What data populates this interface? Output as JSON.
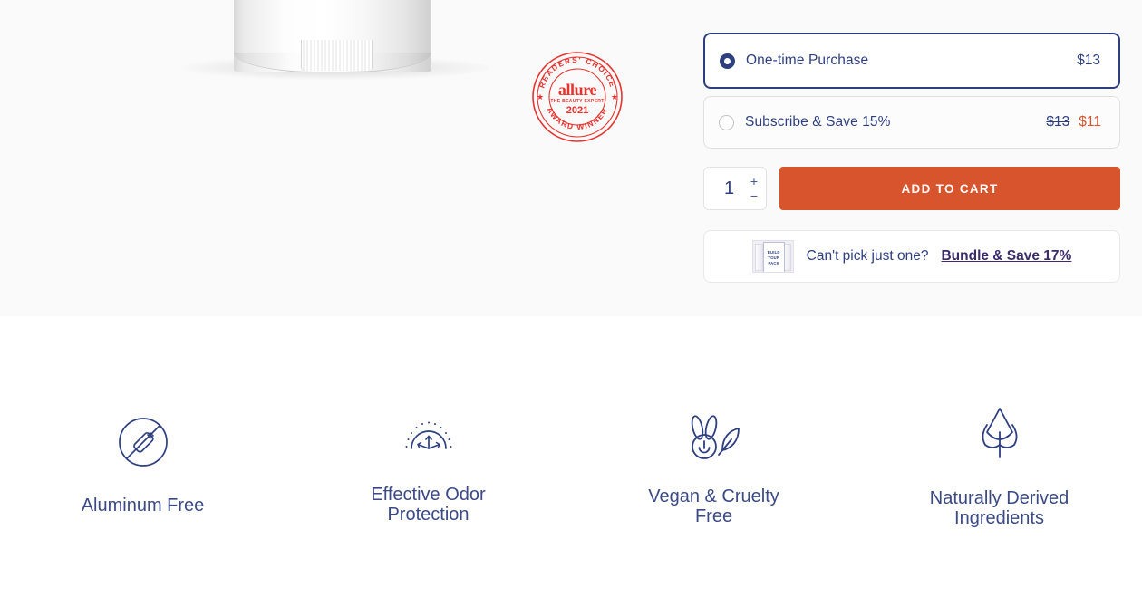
{
  "product": {
    "image_alt": "white-deodorant-stick"
  },
  "award_badge": {
    "name": "allure-readers-choice-badge",
    "brand": "allure",
    "tagline": "THE BEAUTY EXPERT",
    "year": "2021",
    "arc_top": "READERS' CHOICE",
    "arc_bottom": "AWARD WINNER",
    "color": "#e8322e"
  },
  "purchase_options": [
    {
      "label": "One-time Purchase",
      "price": "$13",
      "selected": true
    },
    {
      "label": "Subscribe & Save 15%",
      "price_original": "$13",
      "price_sale": "$11",
      "selected": false
    }
  ],
  "quantity": {
    "value": "1",
    "increment": "+",
    "decrement": "−"
  },
  "add_to_cart": {
    "label": "ADD TO CART",
    "color": "#d8542c"
  },
  "bundle": {
    "thumbnail_lines": [
      "BUILD",
      "YOUR",
      "PACK"
    ],
    "question": "Can't pick just one?",
    "link": "Bundle & Save 17%"
  },
  "features": [
    {
      "icon": "no-aluminum-icon",
      "label": "Aluminum Free"
    },
    {
      "icon": "odor-protection-icon",
      "label": "Effective Odor Protection"
    },
    {
      "icon": "bunny-leaf-icon",
      "label": "Vegan & Cruelty Free"
    },
    {
      "icon": "leaf-sprout-icon",
      "label": "Naturally Derived Ingredients"
    }
  ],
  "theme": {
    "navy": "#2e3f7f",
    "orange": "#d8542c",
    "section_bg": "#fafafa"
  }
}
